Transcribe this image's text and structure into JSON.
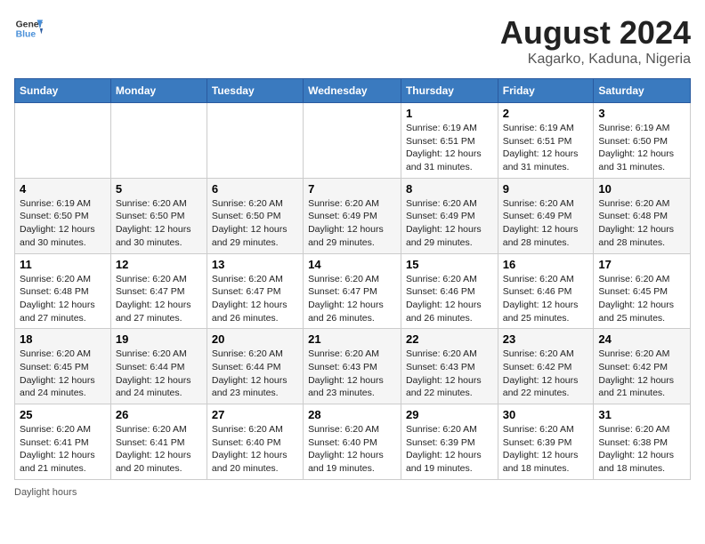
{
  "header": {
    "logo_line1": "General",
    "logo_line2": "Blue",
    "title": "August 2024",
    "subtitle": "Kagarko, Kaduna, Nigeria"
  },
  "days_of_week": [
    "Sunday",
    "Monday",
    "Tuesday",
    "Wednesday",
    "Thursday",
    "Friday",
    "Saturday"
  ],
  "footer_label": "Daylight hours",
  "weeks": [
    [
      {
        "day": "",
        "info": ""
      },
      {
        "day": "",
        "info": ""
      },
      {
        "day": "",
        "info": ""
      },
      {
        "day": "",
        "info": ""
      },
      {
        "day": "1",
        "info": "Sunrise: 6:19 AM\nSunset: 6:51 PM\nDaylight: 12 hours and 31 minutes."
      },
      {
        "day": "2",
        "info": "Sunrise: 6:19 AM\nSunset: 6:51 PM\nDaylight: 12 hours and 31 minutes."
      },
      {
        "day": "3",
        "info": "Sunrise: 6:19 AM\nSunset: 6:50 PM\nDaylight: 12 hours and 31 minutes."
      }
    ],
    [
      {
        "day": "4",
        "info": "Sunrise: 6:19 AM\nSunset: 6:50 PM\nDaylight: 12 hours and 30 minutes."
      },
      {
        "day": "5",
        "info": "Sunrise: 6:20 AM\nSunset: 6:50 PM\nDaylight: 12 hours and 30 minutes."
      },
      {
        "day": "6",
        "info": "Sunrise: 6:20 AM\nSunset: 6:50 PM\nDaylight: 12 hours and 29 minutes."
      },
      {
        "day": "7",
        "info": "Sunrise: 6:20 AM\nSunset: 6:49 PM\nDaylight: 12 hours and 29 minutes."
      },
      {
        "day": "8",
        "info": "Sunrise: 6:20 AM\nSunset: 6:49 PM\nDaylight: 12 hours and 29 minutes."
      },
      {
        "day": "9",
        "info": "Sunrise: 6:20 AM\nSunset: 6:49 PM\nDaylight: 12 hours and 28 minutes."
      },
      {
        "day": "10",
        "info": "Sunrise: 6:20 AM\nSunset: 6:48 PM\nDaylight: 12 hours and 28 minutes."
      }
    ],
    [
      {
        "day": "11",
        "info": "Sunrise: 6:20 AM\nSunset: 6:48 PM\nDaylight: 12 hours and 27 minutes."
      },
      {
        "day": "12",
        "info": "Sunrise: 6:20 AM\nSunset: 6:47 PM\nDaylight: 12 hours and 27 minutes."
      },
      {
        "day": "13",
        "info": "Sunrise: 6:20 AM\nSunset: 6:47 PM\nDaylight: 12 hours and 26 minutes."
      },
      {
        "day": "14",
        "info": "Sunrise: 6:20 AM\nSunset: 6:47 PM\nDaylight: 12 hours and 26 minutes."
      },
      {
        "day": "15",
        "info": "Sunrise: 6:20 AM\nSunset: 6:46 PM\nDaylight: 12 hours and 26 minutes."
      },
      {
        "day": "16",
        "info": "Sunrise: 6:20 AM\nSunset: 6:46 PM\nDaylight: 12 hours and 25 minutes."
      },
      {
        "day": "17",
        "info": "Sunrise: 6:20 AM\nSunset: 6:45 PM\nDaylight: 12 hours and 25 minutes."
      }
    ],
    [
      {
        "day": "18",
        "info": "Sunrise: 6:20 AM\nSunset: 6:45 PM\nDaylight: 12 hours and 24 minutes."
      },
      {
        "day": "19",
        "info": "Sunrise: 6:20 AM\nSunset: 6:44 PM\nDaylight: 12 hours and 24 minutes."
      },
      {
        "day": "20",
        "info": "Sunrise: 6:20 AM\nSunset: 6:44 PM\nDaylight: 12 hours and 23 minutes."
      },
      {
        "day": "21",
        "info": "Sunrise: 6:20 AM\nSunset: 6:43 PM\nDaylight: 12 hours and 23 minutes."
      },
      {
        "day": "22",
        "info": "Sunrise: 6:20 AM\nSunset: 6:43 PM\nDaylight: 12 hours and 22 minutes."
      },
      {
        "day": "23",
        "info": "Sunrise: 6:20 AM\nSunset: 6:42 PM\nDaylight: 12 hours and 22 minutes."
      },
      {
        "day": "24",
        "info": "Sunrise: 6:20 AM\nSunset: 6:42 PM\nDaylight: 12 hours and 21 minutes."
      }
    ],
    [
      {
        "day": "25",
        "info": "Sunrise: 6:20 AM\nSunset: 6:41 PM\nDaylight: 12 hours and 21 minutes."
      },
      {
        "day": "26",
        "info": "Sunrise: 6:20 AM\nSunset: 6:41 PM\nDaylight: 12 hours and 20 minutes."
      },
      {
        "day": "27",
        "info": "Sunrise: 6:20 AM\nSunset: 6:40 PM\nDaylight: 12 hours and 20 minutes."
      },
      {
        "day": "28",
        "info": "Sunrise: 6:20 AM\nSunset: 6:40 PM\nDaylight: 12 hours and 19 minutes."
      },
      {
        "day": "29",
        "info": "Sunrise: 6:20 AM\nSunset: 6:39 PM\nDaylight: 12 hours and 19 minutes."
      },
      {
        "day": "30",
        "info": "Sunrise: 6:20 AM\nSunset: 6:39 PM\nDaylight: 12 hours and 18 minutes."
      },
      {
        "day": "31",
        "info": "Sunrise: 6:20 AM\nSunset: 6:38 PM\nDaylight: 12 hours and 18 minutes."
      }
    ]
  ]
}
